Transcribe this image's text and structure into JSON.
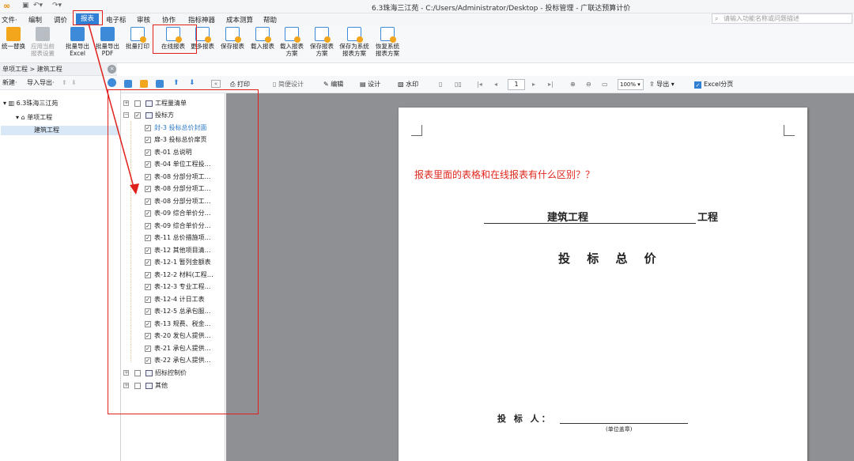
{
  "titlebar": {
    "title": "6.3珠海三江苑 - C:/Users/Administrator/Desktop - 投标管理 - 广联达预算计价"
  },
  "menu": [
    {
      "label": "文件·"
    },
    {
      "label": "编制"
    },
    {
      "label": "调价"
    },
    {
      "label": "报表"
    },
    {
      "label": "电子标"
    },
    {
      "label": "审核"
    },
    {
      "label": "协作"
    },
    {
      "label": "指标神器"
    },
    {
      "label": "成本测算"
    },
    {
      "label": "帮助"
    }
  ],
  "search": {
    "placeholder": "请输入功能名称或问题描述"
  },
  "ribbon": [
    {
      "label": "统一替换",
      "sub": ""
    },
    {
      "label": "应用当前",
      "sub": "报表设置"
    },
    {
      "label": "批量导出",
      "sub": "Excel"
    },
    {
      "label": "批量导出",
      "sub": "PDF"
    },
    {
      "label": "批量打印",
      "sub": ""
    },
    {
      "label": "在线报表",
      "sub": ""
    },
    {
      "label": "更多报表",
      "sub": ""
    },
    {
      "label": "保存报表",
      "sub": ""
    },
    {
      "label": "载入报表",
      "sub": ""
    },
    {
      "label": "载入报表",
      "sub": "方案"
    },
    {
      "label": "保存报表",
      "sub": "方案"
    },
    {
      "label": "保存为系统",
      "sub": "报表方案"
    },
    {
      "label": "恢复系统",
      "sub": "报表方案"
    }
  ],
  "breadcrumb": "单项工程 > 建筑工程",
  "left_toolbar": {
    "new": "新建·",
    "import_export": "导入导出·"
  },
  "left_tree": {
    "root": "6.3珠海三江苑",
    "child": "单项工程",
    "leaf": "建筑工程"
  },
  "report_tree": {
    "groups": [
      {
        "label": "工程量清单"
      },
      {
        "label": "投标方"
      },
      {
        "label": "招标控制价"
      },
      {
        "label": "其他"
      }
    ],
    "items": [
      {
        "label": "封-3 投标总价封面"
      },
      {
        "label": "扉-3 投标总价扉页"
      },
      {
        "label": "表-01 总说明"
      },
      {
        "label": "表-04 单位工程投…"
      },
      {
        "label": "表-08 分部分项工…"
      },
      {
        "label": "表-08 分部分项工…"
      },
      {
        "label": "表-08 分部分项工…"
      },
      {
        "label": "表-09 综合单价分…"
      },
      {
        "label": "表-09 综合单价分…"
      },
      {
        "label": "表-11 总价措施项…"
      },
      {
        "label": "表-12 其他项目清…"
      },
      {
        "label": "表-12-1 暂列金额表"
      },
      {
        "label": "表-12-2 材料(工程…"
      },
      {
        "label": "表-12-3 专业工程…"
      },
      {
        "label": "表-12-4 计日工表"
      },
      {
        "label": "表-12-5 总承包服…"
      },
      {
        "label": "表-13 规费、税金…"
      },
      {
        "label": "表-20 发包人提供…"
      },
      {
        "label": "表-21 承包人提供…"
      },
      {
        "label": "表-22 承包人提供…"
      }
    ]
  },
  "preview_toolbar": {
    "print": "打印",
    "page_design": "简便设计",
    "edit": "编辑",
    "design": "设计",
    "watermark": "水印",
    "page": "1",
    "zoom": "100%",
    "export": "导出",
    "excel_paging": "Excel分页"
  },
  "paper": {
    "annotation": "报表里面的表格和在线报表有什么区别？？",
    "project_name": "建筑工程",
    "project_suffix": "工程",
    "title": "投 标 总 价",
    "bidder_label": "投 标 人：",
    "seal_note": "(单位盖章)"
  },
  "colors": {
    "accent": "#2f7fd4",
    "highlight_red": "#e0201b",
    "preview_bg": "#8f9093"
  }
}
